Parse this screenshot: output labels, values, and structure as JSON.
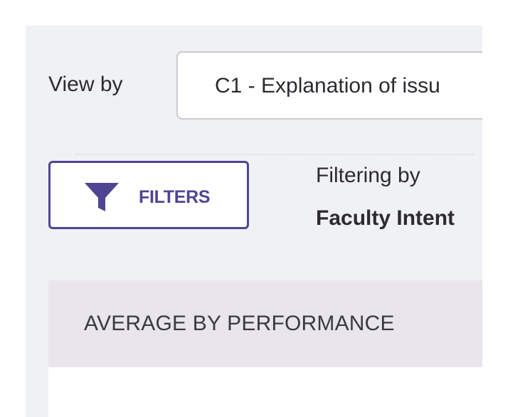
{
  "view_by": {
    "label": "View by",
    "selected_value": "C1 - Explanation of issu"
  },
  "filters": {
    "button_label": "FILTERS",
    "icon": "funnel-icon",
    "filtering_label": "Filtering by",
    "filtering_value": "Faculty Intent"
  },
  "section": {
    "title": "AVERAGE BY PERFORMANCE"
  },
  "colors": {
    "accent": "#4e4693",
    "panel_bg": "#f0f1f4",
    "header_bg": "#e8e6ec",
    "text": "#2b2b30"
  }
}
